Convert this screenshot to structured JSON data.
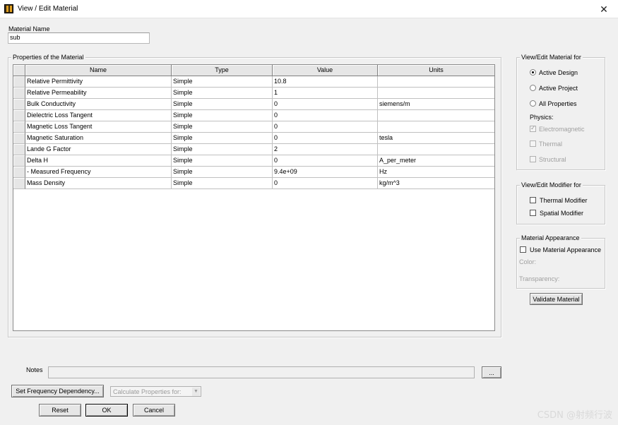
{
  "window": {
    "title": "View / Edit Material",
    "close_glyph": "✕",
    "app_icon": "ansys-icon"
  },
  "material_name": {
    "label": "Material Name",
    "value": "sub"
  },
  "properties": {
    "group_title": "Properties of the Material",
    "columns": [
      "Name",
      "Type",
      "Value",
      "Units"
    ],
    "rows": [
      [
        "Relative Permittivity",
        "Simple",
        "10.8",
        ""
      ],
      [
        "Relative Permeability",
        "Simple",
        "1",
        ""
      ],
      [
        "Bulk Conductivity",
        "Simple",
        "0",
        "siemens/m"
      ],
      [
        "Dielectric Loss Tangent",
        "Simple",
        "0",
        ""
      ],
      [
        "Magnetic Loss Tangent",
        "Simple",
        "0",
        ""
      ],
      [
        "Magnetic Saturation",
        "Simple",
        "0",
        "tesla"
      ],
      [
        "Lande G Factor",
        "Simple",
        "2",
        ""
      ],
      [
        "Delta H",
        "Simple",
        "0",
        "A_per_meter"
      ],
      [
        "-  Measured Frequency",
        "Simple",
        "9.4e+09",
        "Hz"
      ],
      [
        "Mass Density",
        "Simple",
        "0",
        "kg/m^3"
      ]
    ]
  },
  "view_edit_for": {
    "title": "View/Edit Material for",
    "options": [
      {
        "label": "Active Design",
        "selected": true
      },
      {
        "label": "Active Project",
        "selected": false
      },
      {
        "label": "All Properties",
        "selected": false
      }
    ],
    "physics_label": "Physics:",
    "physics": [
      {
        "label": "Electromagnetic",
        "checked": true,
        "enabled": false
      },
      {
        "label": "Thermal",
        "checked": false,
        "enabled": false
      },
      {
        "label": "Structural",
        "checked": false,
        "enabled": false
      }
    ]
  },
  "modifier_for": {
    "title": "View/Edit Modifier for",
    "items": [
      {
        "label": "Thermal Modifier",
        "checked": false
      },
      {
        "label": "Spatial Modifier",
        "checked": false
      }
    ]
  },
  "appearance": {
    "title": "Material Appearance",
    "use_label": "Use Material Appearance",
    "color_label": "Color:",
    "transparency_label": "Transparency:"
  },
  "buttons": {
    "validate": "Validate Material",
    "set_freq": "Set Frequency Dependency...",
    "browse": "...",
    "reset": "Reset",
    "ok": "OK",
    "cancel": "Cancel"
  },
  "notes": {
    "label": "Notes",
    "value": ""
  },
  "calc_dropdown": {
    "value": "Calculate Properties for:"
  },
  "watermark": "CSDN @射频行波"
}
